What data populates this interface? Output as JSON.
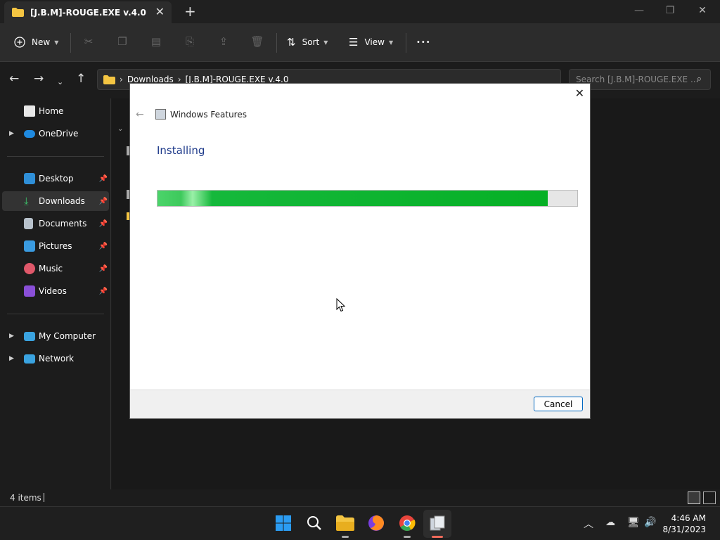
{
  "explorer": {
    "tab_title": "[J.B.M]-ROUGE.EXE v.4.0",
    "toolbar": {
      "new_label": "New",
      "sort_label": "Sort",
      "view_label": "View",
      "more_label": "•••"
    },
    "address": {
      "crumb_1": "Downloads",
      "crumb_2": "[J.B.M]-ROUGE.EXE v.4.0"
    },
    "search_placeholder": "Search [J.B.M]-ROUGE.EXE ...",
    "nav": {
      "home": "Home",
      "onedrive": "OneDrive",
      "desktop": "Desktop",
      "downloads": "Downloads",
      "documents": "Documents",
      "pictures": "Pictures",
      "music": "Music",
      "videos": "Videos",
      "my_computer": "My Computer",
      "network": "Network"
    },
    "status": "4 items"
  },
  "dialog": {
    "app_title": "Windows Features",
    "heading": "Installing",
    "progress_percent": 93,
    "cancel_label": "Cancel"
  },
  "taskbar": {
    "time": "4:46 AM",
    "date": "8/31/2023"
  },
  "colors": {
    "progress_green": "#06b025",
    "heading_blue": "#1e3a8a",
    "button_border": "#0067c0"
  }
}
